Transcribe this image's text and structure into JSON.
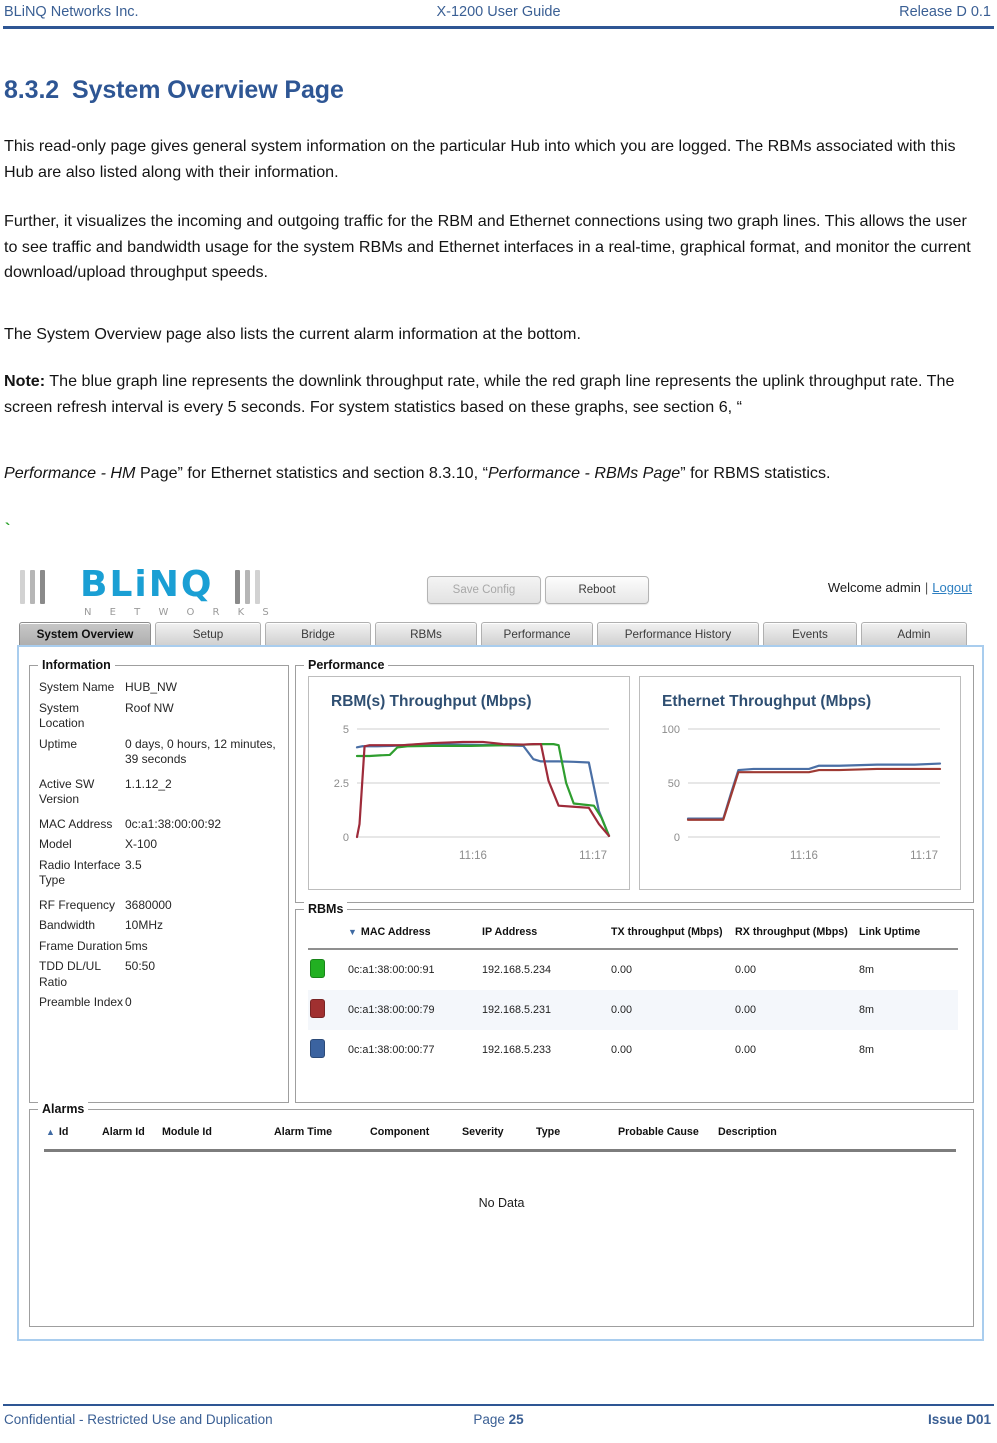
{
  "doc": {
    "header": {
      "left": "BLiNQ Networks Inc.",
      "center": "X-1200 User Guide",
      "right": "Release D 0.1"
    },
    "heading": {
      "number": "8.3.2",
      "title": "System Overview Page"
    },
    "paragraphs": {
      "p1": "This read-only page gives general system information on the particular Hub into which you are logged. The RBMs associated with this Hub are also listed along with their information.",
      "p2": "Further, it visualizes the incoming and outgoing traffic for the RBM and Ethernet connections using two graph lines. This allows the user to see traffic and bandwidth usage for the system RBMs and Ethernet interfaces in a real-time, graphical format, and monitor the current download/upload throughput speeds.",
      "p3": "The System Overview page also lists the current alarm information at the bottom.",
      "p4_label": "Note:",
      "p4_body": " The blue graph line represents the downlink throughput rate, while the red graph line represents the uplink throughput rate. The screen refresh interval is every 5 seconds.  For system statistics based on these graphs, see section 6, “",
      "p5_a": "Performance - HM",
      "p5_b": " Page” for Ethernet statistics and section 8.3.10, “",
      "p5_c": "Performance - RBMs Page",
      "p5_d": "” for RBMS statistics.",
      "tick": "`"
    },
    "footer": {
      "left": "Confidential - Restricted Use and Duplication",
      "center_label": "Page ",
      "center_value": "25",
      "right": "Issue D01"
    }
  },
  "app": {
    "logo": {
      "word": "BLiNQ",
      "subtitle": "N E T W O R K S"
    },
    "toolbar": {
      "save_config": "Save Config",
      "reboot": "Reboot",
      "welcome": "Welcome admin",
      "separator": "|",
      "logout": "Logout"
    },
    "tabs": [
      {
        "label": "System Overview",
        "active": true
      },
      {
        "label": "Setup",
        "active": false
      },
      {
        "label": "Bridge",
        "active": false
      },
      {
        "label": "RBMs",
        "active": false
      },
      {
        "label": "Performance",
        "active": false
      },
      {
        "label": "Performance History",
        "active": false
      },
      {
        "label": "Events",
        "active": false
      },
      {
        "label": "Admin",
        "active": false
      }
    ],
    "information": {
      "legend": "Information",
      "rows": [
        {
          "key": "System Name",
          "value": "HUB_NW"
        },
        {
          "key": "System Location",
          "value": "Roof NW"
        },
        {
          "key": "Uptime",
          "value": "0 days, 0 hours, 12 minutes, 39 seconds"
        },
        {
          "key": "Active SW Version",
          "value": "1.1.12_2"
        },
        {
          "key": "MAC Address",
          "value": "0c:a1:38:00:00:92"
        },
        {
          "key": "Model",
          "value": "X-100"
        },
        {
          "key": "Radio Interface Type",
          "value": "3.5"
        },
        {
          "key": "RF Frequency",
          "value": "3680000"
        },
        {
          "key": "Bandwidth",
          "value": "10MHz"
        },
        {
          "key": "Frame Duration",
          "value": "5ms"
        },
        {
          "key": "TDD DL/UL Ratio",
          "value": "50:50"
        },
        {
          "key": "Preamble Index",
          "value": "0"
        }
      ]
    },
    "performance": {
      "legend": "Performance"
    },
    "rbms": {
      "legend": "RBMs",
      "sort_caret": "▼",
      "columns": [
        {
          "label": "MAC Address",
          "sorted": true
        },
        {
          "label": "IP Address",
          "sorted": false
        },
        {
          "label": "TX throughput (Mbps)",
          "sorted": false
        },
        {
          "label": "RX throughput (Mbps)",
          "sorted": false
        },
        {
          "label": "Link Uptime",
          "sorted": false
        }
      ],
      "rows": [
        {
          "color": "#22b022",
          "mac": "0c:a1:38:00:00:91",
          "ip": "192.168.5.234",
          "tx": "0.00",
          "rx": "0.00",
          "uptime": "8m"
        },
        {
          "color": "#a03030",
          "mac": "0c:a1:38:00:00:79",
          "ip": "192.168.5.231",
          "tx": "0.00",
          "rx": "0.00",
          "uptime": "8m"
        },
        {
          "color": "#3b63a0",
          "mac": "0c:a1:38:00:00:77",
          "ip": "192.168.5.233",
          "tx": "0.00",
          "rx": "0.00",
          "uptime": "8m"
        }
      ]
    },
    "alarms": {
      "legend": "Alarms",
      "sort_caret": "▲",
      "columns": [
        "Id",
        "Alarm Id",
        "Module Id",
        "Alarm Time",
        "Component",
        "Severity",
        "Type",
        "Probable Cause",
        "Description"
      ],
      "empty_text": "No Data"
    }
  },
  "chart_data": [
    {
      "id": "rbm",
      "type": "line",
      "title": "RBM(s) Throughput (Mbps)",
      "xlabel": "",
      "ylabel": "",
      "ylim": [
        0,
        5
      ],
      "yticks": [
        "0",
        "2.5",
        "5"
      ],
      "xticks": [
        "11:16",
        "11:17"
      ],
      "grid": true,
      "legend": "none",
      "series": [
        {
          "name": "blue",
          "color": "#4a6fa5",
          "x": [
            0,
            2,
            4,
            8,
            14,
            26,
            42,
            58,
            66,
            70,
            73,
            76,
            80,
            86,
            92,
            96,
            100
          ],
          "values": [
            4.15,
            4.2,
            4.2,
            4.2,
            4.22,
            4.3,
            4.28,
            4.25,
            4.22,
            3.6,
            3.5,
            3.5,
            3.5,
            3.48,
            3.45,
            1.2,
            0.05
          ]
        },
        {
          "name": "green",
          "color": "#2f9e2f",
          "x": [
            0,
            2,
            5,
            9,
            13,
            16,
            20,
            30,
            45,
            60,
            72,
            78,
            80,
            83,
            86,
            90,
            94,
            97,
            100
          ],
          "values": [
            3.75,
            3.75,
            3.75,
            3.78,
            3.8,
            4.15,
            4.2,
            4.22,
            4.22,
            4.25,
            4.3,
            4.3,
            4.25,
            2.5,
            1.55,
            1.5,
            1.45,
            0.9,
            0.05
          ]
        },
        {
          "name": "red",
          "color": "#9e2b3a",
          "x": [
            0,
            1,
            3,
            5,
            9,
            18,
            30,
            42,
            50,
            58,
            66,
            70,
            73,
            76,
            80,
            86,
            92,
            96,
            100
          ],
          "values": [
            0.0,
            0.6,
            4.2,
            4.25,
            4.25,
            4.25,
            4.35,
            4.4,
            4.4,
            4.3,
            4.28,
            4.3,
            4.3,
            2.6,
            1.45,
            1.4,
            1.35,
            0.6,
            0.05
          ]
        }
      ]
    },
    {
      "id": "ethernet",
      "type": "line",
      "title": "Ethernet Throughput (Mbps)",
      "xlabel": "",
      "ylabel": "",
      "ylim": [
        0,
        100
      ],
      "yticks": [
        "0",
        "50",
        "100"
      ],
      "xticks": [
        "11:16",
        "11:17"
      ],
      "grid": true,
      "legend": "none",
      "series": [
        {
          "name": "blue",
          "color": "#4a6fa5",
          "x": [
            0,
            8,
            14,
            17,
            20,
            26,
            40,
            48,
            52,
            60,
            75,
            90,
            100
          ],
          "values": [
            17,
            17,
            17,
            40,
            62,
            63,
            63,
            63,
            66,
            66,
            67,
            67,
            68
          ]
        },
        {
          "name": "red",
          "color": "#9e3a33",
          "x": [
            0,
            8,
            14,
            17,
            20,
            26,
            40,
            48,
            52,
            60,
            75,
            90,
            100
          ],
          "values": [
            16,
            16,
            16,
            38,
            60,
            60,
            60,
            60,
            62,
            62,
            63,
            63,
            63
          ]
        }
      ]
    }
  ]
}
